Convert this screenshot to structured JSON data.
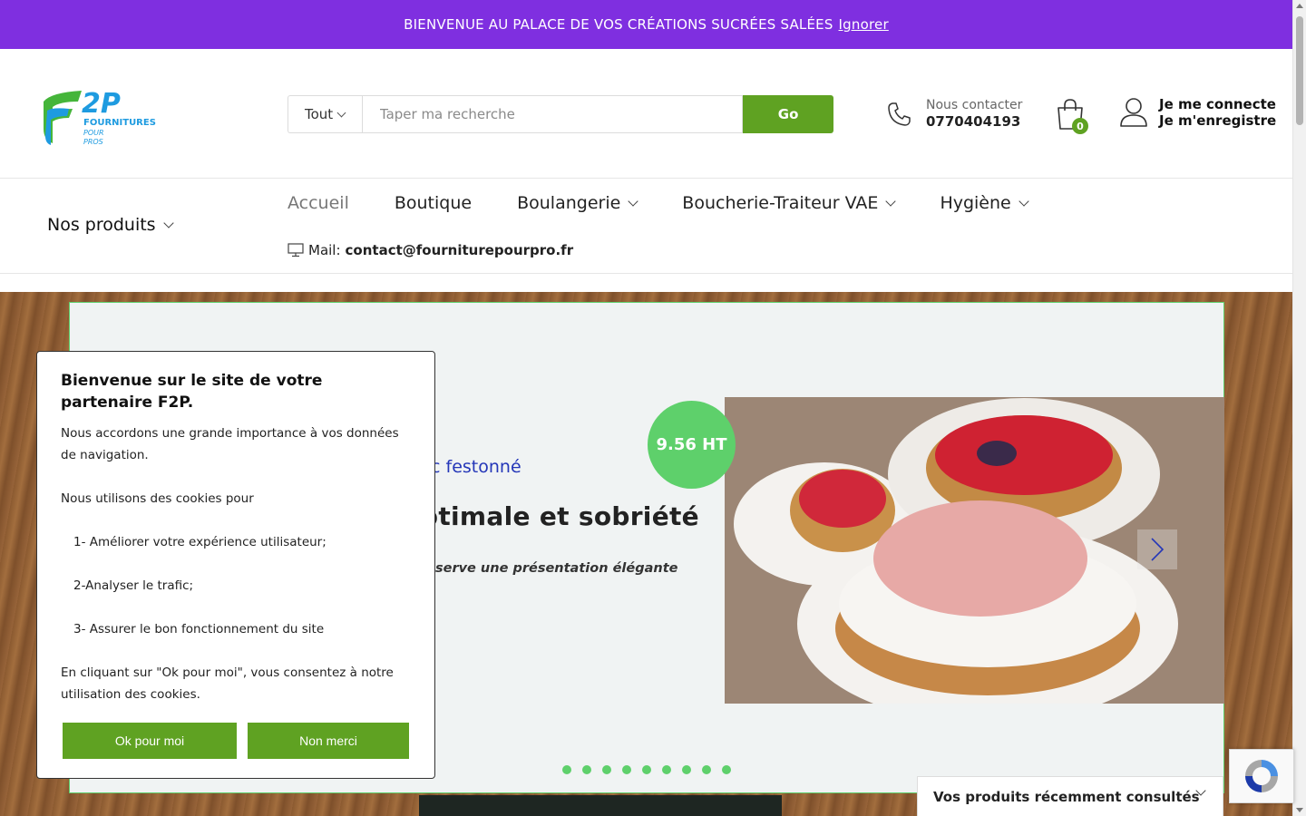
{
  "promo": {
    "message": "BIENVENUE AU PALACE DE VOS CRÉATIONS SUCRÉES SALÉES",
    "dismiss": "Ignorer"
  },
  "logo": {
    "mark": "2P",
    "line1": "FOURNITURES",
    "line2": "POUR",
    "line3": "PROS"
  },
  "search": {
    "category": "Tout",
    "placeholder": "Taper ma recherche",
    "button": "Go"
  },
  "contact": {
    "label": "Nous contacter",
    "phone": "0770404193"
  },
  "cart": {
    "count": "0"
  },
  "account": {
    "login": "Je me connecte",
    "register": "Je m'enregistre"
  },
  "nav": {
    "products": "Nos produits",
    "items": [
      {
        "label": "Accueil",
        "dropdown": false
      },
      {
        "label": "Boutique",
        "dropdown": false
      },
      {
        "label": "Boulangerie",
        "dropdown": true
      },
      {
        "label": "Boucherie-Traiteur VAE",
        "dropdown": true
      },
      {
        "label": "Hygiène",
        "dropdown": true
      }
    ],
    "mail_label": "Mail:",
    "mail_value": "contact@fourniturepourpro.fr"
  },
  "slide": {
    "subtitle": "nc festonné",
    "title": "ptimale et sobriété",
    "tagline": "réserve une présentation élégante",
    "price": "9.56 HT",
    "dots": 9
  },
  "cookie": {
    "title": "Bienvenue sur le site de votre partenaire F2P.",
    "intro": "Nous accordons une grande importance à vos données de navigation.",
    "uses_intro": "Nous utilisons des cookies pour",
    "uses": [
      "1- Améliorer votre expérience utilisateur;",
      "2-Analyser le trafic;",
      "3- Assurer le bon fonctionnement du site"
    ],
    "consent": "En cliquant sur \"Ok pour moi\", vous consentez à notre utilisation des cookies.",
    "accept": "Ok pour moi",
    "decline": "Non merci"
  },
  "recent": {
    "label": "Vos produits récemment consultés"
  },
  "colors": {
    "promo": "#7f2fe0",
    "accent_green": "#5fa222",
    "price_green": "#5ed06b",
    "subtitle_blue": "#2436b8"
  }
}
